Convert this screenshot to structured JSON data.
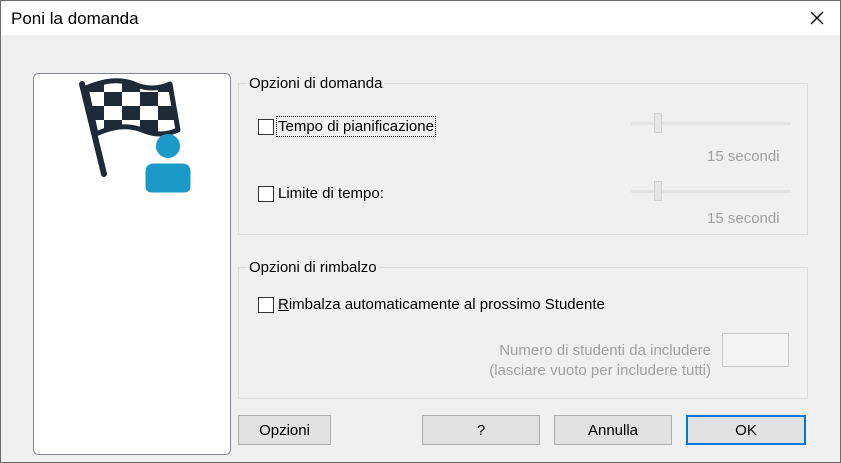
{
  "window": {
    "title": "Poni la domanda"
  },
  "question_options": {
    "label": "Opzioni di domanda",
    "planning_time": {
      "label": "Tempo di pianificazione",
      "checked": false,
      "value_text": "15 secondi",
      "slider_level": 0.17
    },
    "time_limit": {
      "label": "Limite di tempo:",
      "checked": false,
      "value_text": "15 secondi",
      "slider_level": 0.17
    }
  },
  "bounce_options": {
    "label": "Opzioni di rimbalzo",
    "auto_bounce": {
      "label": "Rimbalza automaticamente al prossimo Studente",
      "checked": false
    },
    "num_students_line1": "Numero di studenti da includere",
    "num_students_line2": "(lasciare vuoto per includere tutti)",
    "num_students_value": ""
  },
  "buttons": {
    "options": "Opzioni",
    "help": "?",
    "cancel": "Annulla",
    "ok": "OK"
  },
  "icons": {
    "illustration": "checkered-flag-student-icon",
    "close": "close-icon"
  },
  "colors": {
    "accent": "#0078d7",
    "icon_dark": "#1e2a38",
    "icon_teal": "#1b9ac8"
  }
}
